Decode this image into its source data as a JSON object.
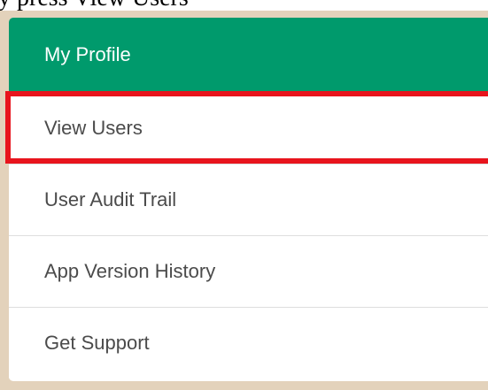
{
  "top_text": "y press View Users",
  "menu": {
    "header_label": "My Profile",
    "items": [
      {
        "label": "View Users"
      },
      {
        "label": "User Audit Trail"
      },
      {
        "label": "App Version History"
      },
      {
        "label": "Get Support"
      }
    ]
  },
  "colors": {
    "header_background": "#009a6c",
    "highlight_border": "#e8141d",
    "outer_background": "#e3d2bb"
  }
}
